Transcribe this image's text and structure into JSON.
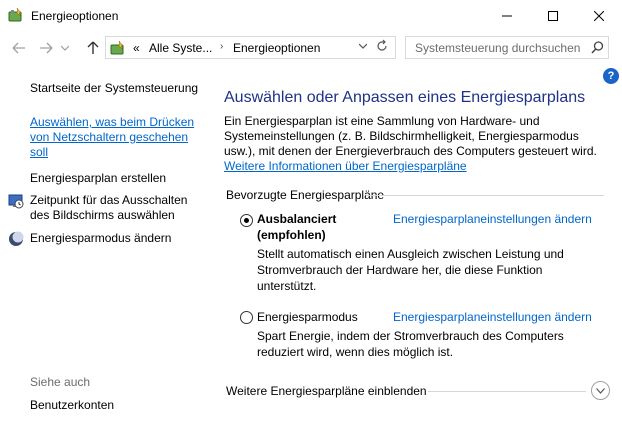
{
  "window": {
    "title": "Energieoptionen"
  },
  "address": {
    "overflow": "«",
    "crumbs": [
      "Alle Syste...",
      "Energieoptionen"
    ],
    "separator": "›"
  },
  "search": {
    "placeholder": "Systemsteuerung durchsuchen"
  },
  "sidebar": {
    "items": [
      {
        "label": "Startseite der Systemsteuerung",
        "icon": ""
      },
      {
        "label": "Auswählen, was beim Drücken von Netzschaltern geschehen soll",
        "icon": ""
      },
      {
        "label": "Energiesparplan erstellen",
        "icon": ""
      },
      {
        "label": "Zeitpunkt für das Ausschalten des Bildschirms auswählen",
        "icon": "monitor-clock-icon"
      },
      {
        "label": "Energiesparmodus ändern",
        "icon": "moon-icon"
      }
    ],
    "see_also": "Siehe auch",
    "see_also_items": [
      "Benutzerkonten"
    ]
  },
  "main": {
    "title": "Auswählen oder Anpassen eines Energiesparplans",
    "intro": "Ein Energiesparplan ist eine Sammlung von Hardware- und Systemeinstellungen (z. B. Bildschirmhelligkeit, Energiesparmodus usw.), mit denen der Energieverbrauch des Computers gesteuert wird.",
    "intro_link": "Weitere Informationen über Energiesparpläne",
    "section_title": "Bevorzugte Energiesparpläne",
    "plans": [
      {
        "name_line1": "Ausbalanciert",
        "name_line2": "(empfohlen)",
        "selected": true,
        "link": "Energiesparplaneinstellungen ändern",
        "desc_line1": "Stellt automatisch einen Ausgleich zwischen Leistung und",
        "desc_line2": "Stromverbrauch der Hardware her, die diese Funktion",
        "desc_line3": "unterstützt."
      },
      {
        "name_line1": "Energiesparmodus",
        "selected": false,
        "link": "Energiesparplaneinstellungen ändern",
        "desc_line1": "Spart Energie, indem der Stromverbrauch des Computers",
        "desc_line2": "reduziert wird, wenn dies möglich ist."
      }
    ],
    "more_plans": "Weitere Energiesparpläne einblenden"
  },
  "colors": {
    "link": "#0066cc",
    "title": "#1e3287",
    "help": "#1a64c8"
  }
}
